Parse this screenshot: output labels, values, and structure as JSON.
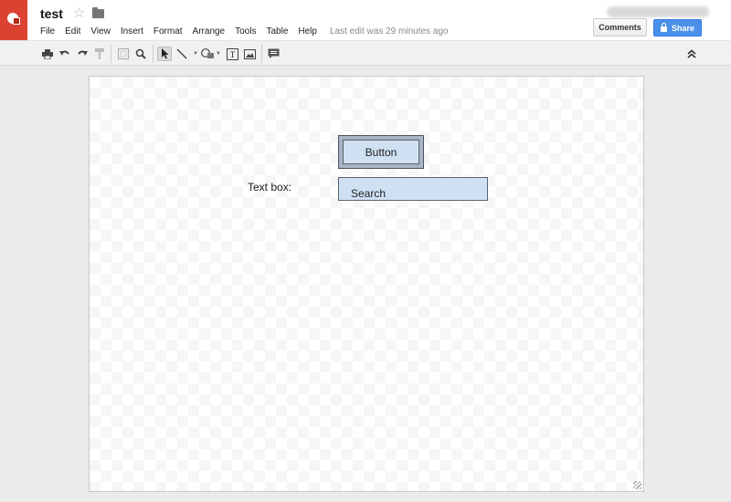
{
  "app": {
    "doc_title": "test",
    "last_edit": "Last edit was 29 minutes ago"
  },
  "menu": {
    "items": [
      {
        "label": "File"
      },
      {
        "label": "Edit"
      },
      {
        "label": "View"
      },
      {
        "label": "Insert"
      },
      {
        "label": "Format"
      },
      {
        "label": "Arrange"
      },
      {
        "label": "Tools"
      },
      {
        "label": "Table"
      },
      {
        "label": "Help"
      }
    ]
  },
  "header": {
    "comments_label": "Comments",
    "share_label": "Share"
  },
  "toolbar": {
    "icons": [
      "print-icon",
      "undo-icon",
      "redo-icon",
      "paint-format-icon",
      "zoom-fit-icon",
      "zoom-icon",
      "select-icon",
      "line-icon",
      "shape-icon",
      "textbox-icon",
      "image-icon",
      "comment-icon",
      "collapse-icon"
    ]
  },
  "canvas": {
    "button_label": "Button",
    "textbox_label": "Text box:",
    "input_value": "Search"
  },
  "colors": {
    "logo": "#dc4232",
    "share": "#4a90e9",
    "shape_fill": "#cfe0f3"
  }
}
